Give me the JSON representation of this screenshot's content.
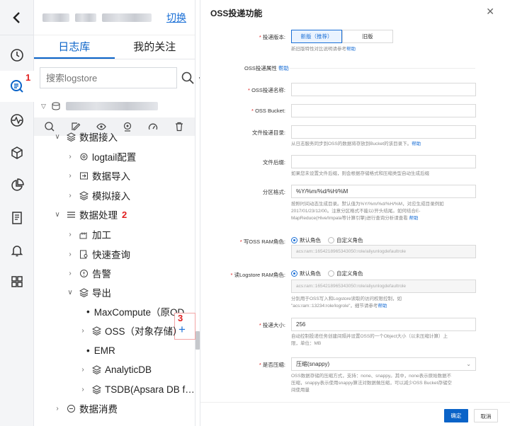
{
  "header": {
    "switch_label": "切换"
  },
  "tabs": [
    {
      "label": "日志库"
    },
    {
      "label": "我的关注"
    }
  ],
  "search": {
    "placeholder": "搜索logstore"
  },
  "rail_badges": {
    "b1": "1"
  },
  "tree": {
    "data_ingest": "数据接入",
    "logtail": "logtail配置",
    "data_import": "数据导入",
    "mock_import": "模拟接入",
    "data_process": "数据处理",
    "process_badge": "2",
    "transform": "加工",
    "quick_query": "快速查询",
    "alert": "告警",
    "export": "导出",
    "maxcompute": "MaxCompute（原OD…",
    "oss": "OSS（对象存储）",
    "oss_badge": "3",
    "add": "+",
    "emr": "EMR",
    "analyticdb": "AnalyticDB",
    "tsdb": "TSDB(Apsara DB f…",
    "data_consume": "数据消费"
  },
  "dialog": {
    "title": "OSS投递功能",
    "version_label": "投递版本:",
    "version_new": "新版（推荐）",
    "version_old": "旧版",
    "version_help": "新旧版特性对比说明请参考",
    "help_link": "帮助",
    "oss_attr": "OSS投递属性",
    "oss_name_label": "OSS投递名称:",
    "oss_bucket_label": "OSS Bucket:",
    "dir_label": "文件投递目录:",
    "dir_help": "从日志服务同步到OSS的数据将存放到Bucket的该目录下。",
    "suffix_label": "文件后缀:",
    "suffix_help": "如果您未设置文件后缀，则会根据存储格式和压缩类型自动生成后缀",
    "partition_label": "分区格式:",
    "partition_value": "%Y/%m/%d/%H/%M",
    "partition_help1": "按照时间动态生成目录。默认值为%Y/%m/%d/%H/%M，对应生成目录例如",
    "partition_help2": "2017/01/23/12/00。注意分区格式不能以/开头结尾。如何结合E-",
    "partition_help3": "MapReduce(Hive/Impala等计算引擎)进行查询分析请查看",
    "write_role_label": "写OSS RAM角色:",
    "read_role_label": "读Logstore RAM角色:",
    "role_default": "默认角色",
    "role_custom": "自定义角色",
    "role_arn": "acs:ram::1654218965343050:role/aliyunlogdefaultrole",
    "read_help1": "分别用于OSS写入和Logstore读取的访问权限控制，如",
    "read_help2": "\"acs:ram::13234:role/logrole\"，细节请参考",
    "size_label": "投递大小:",
    "size_value": "256",
    "size_help1": "自动控制投递任务创建间隔并设置OSS的一个Object大小（以未压缩计算）上",
    "size_help2": "限，单位：MB",
    "compress_label": "是否压缩:",
    "compress_value": "压缩(snappy)",
    "compress_help1": "OSS数据存储的压缩方式，支持：none、snappy。其中，none表示原始数据不",
    "compress_help2": "压缩，snappy表示使用snappy算法对数据做压缩，可以减少OSS Bucket存储空",
    "compress_help3": "间使用量",
    "ok": "确定",
    "cancel": "取消"
  }
}
